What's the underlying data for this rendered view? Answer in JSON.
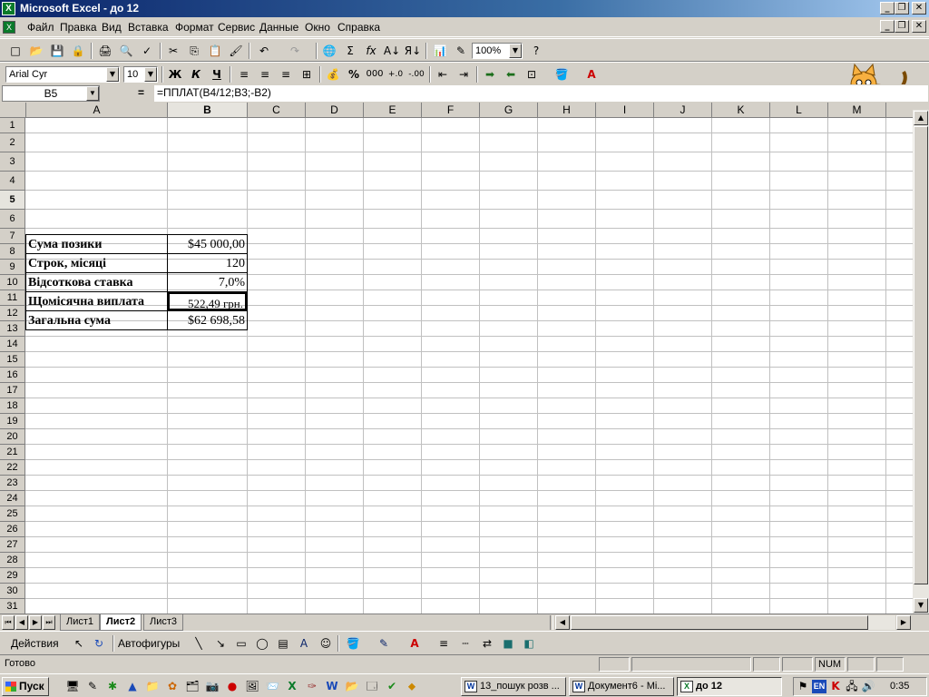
{
  "window": {
    "title": "Microsoft Excel - до 12"
  },
  "menu": [
    "Файл",
    "Правка",
    "Вид",
    "Вставка",
    "Формат",
    "Сервис",
    "Данные",
    "Окно",
    "Справка"
  ],
  "toolbar": {
    "zoom": "100%"
  },
  "format_bar": {
    "font": "Arial Cyr",
    "size": "10",
    "bold": "Ж",
    "italic": "К",
    "underline": "Ч",
    "percent": "%",
    "thousands": "000"
  },
  "formula_bar": {
    "name_box": "B5",
    "eq": "=",
    "formula": "=ППЛАТ(B4/12;B3;-B2)"
  },
  "columns": [
    "A",
    "B",
    "C",
    "D",
    "E",
    "F",
    "G",
    "H",
    "I",
    "J",
    "K",
    "L",
    "M"
  ],
  "rows": [
    "1",
    "2",
    "3",
    "4",
    "5",
    "6",
    "7",
    "8",
    "9",
    "10",
    "11",
    "12",
    "13",
    "14",
    "15",
    "16",
    "17",
    "18",
    "19",
    "20",
    "21",
    "22",
    "23",
    "24",
    "25",
    "26",
    "27",
    "28",
    "29",
    "30",
    "31"
  ],
  "cells": [
    {
      "label": "Сума позики",
      "value": "$45 000,00"
    },
    {
      "label": "Строк, місяці",
      "value": "120"
    },
    {
      "label": "Відсоткова ставка",
      "value": "7,0%"
    },
    {
      "label": "Щомісячна виплата",
      "value": "522,49 грн."
    },
    {
      "label": "Загальна сума",
      "value": "$62 698,58"
    }
  ],
  "sheets": [
    "Лист1",
    "Лист2",
    "Лист3"
  ],
  "draw_bar": {
    "actions": "Действия",
    "autoshapes": "Автофигуры"
  },
  "status": {
    "ready": "Готово",
    "num": "NUM"
  },
  "taskbar": {
    "start": "Пуск",
    "tasks": [
      {
        "icon": "W",
        "label": "13_пошук розв ..."
      },
      {
        "icon": "W",
        "label": "Документ6 - Mi..."
      },
      {
        "icon": "X",
        "label": "до 12"
      }
    ],
    "lang": "EN",
    "clock": "0:35"
  },
  "colors": {
    "title_start": "#0a246a",
    "title_end": "#a6caf0",
    "chrome": "#d4d0c8",
    "grid": "#c0c0c0"
  }
}
